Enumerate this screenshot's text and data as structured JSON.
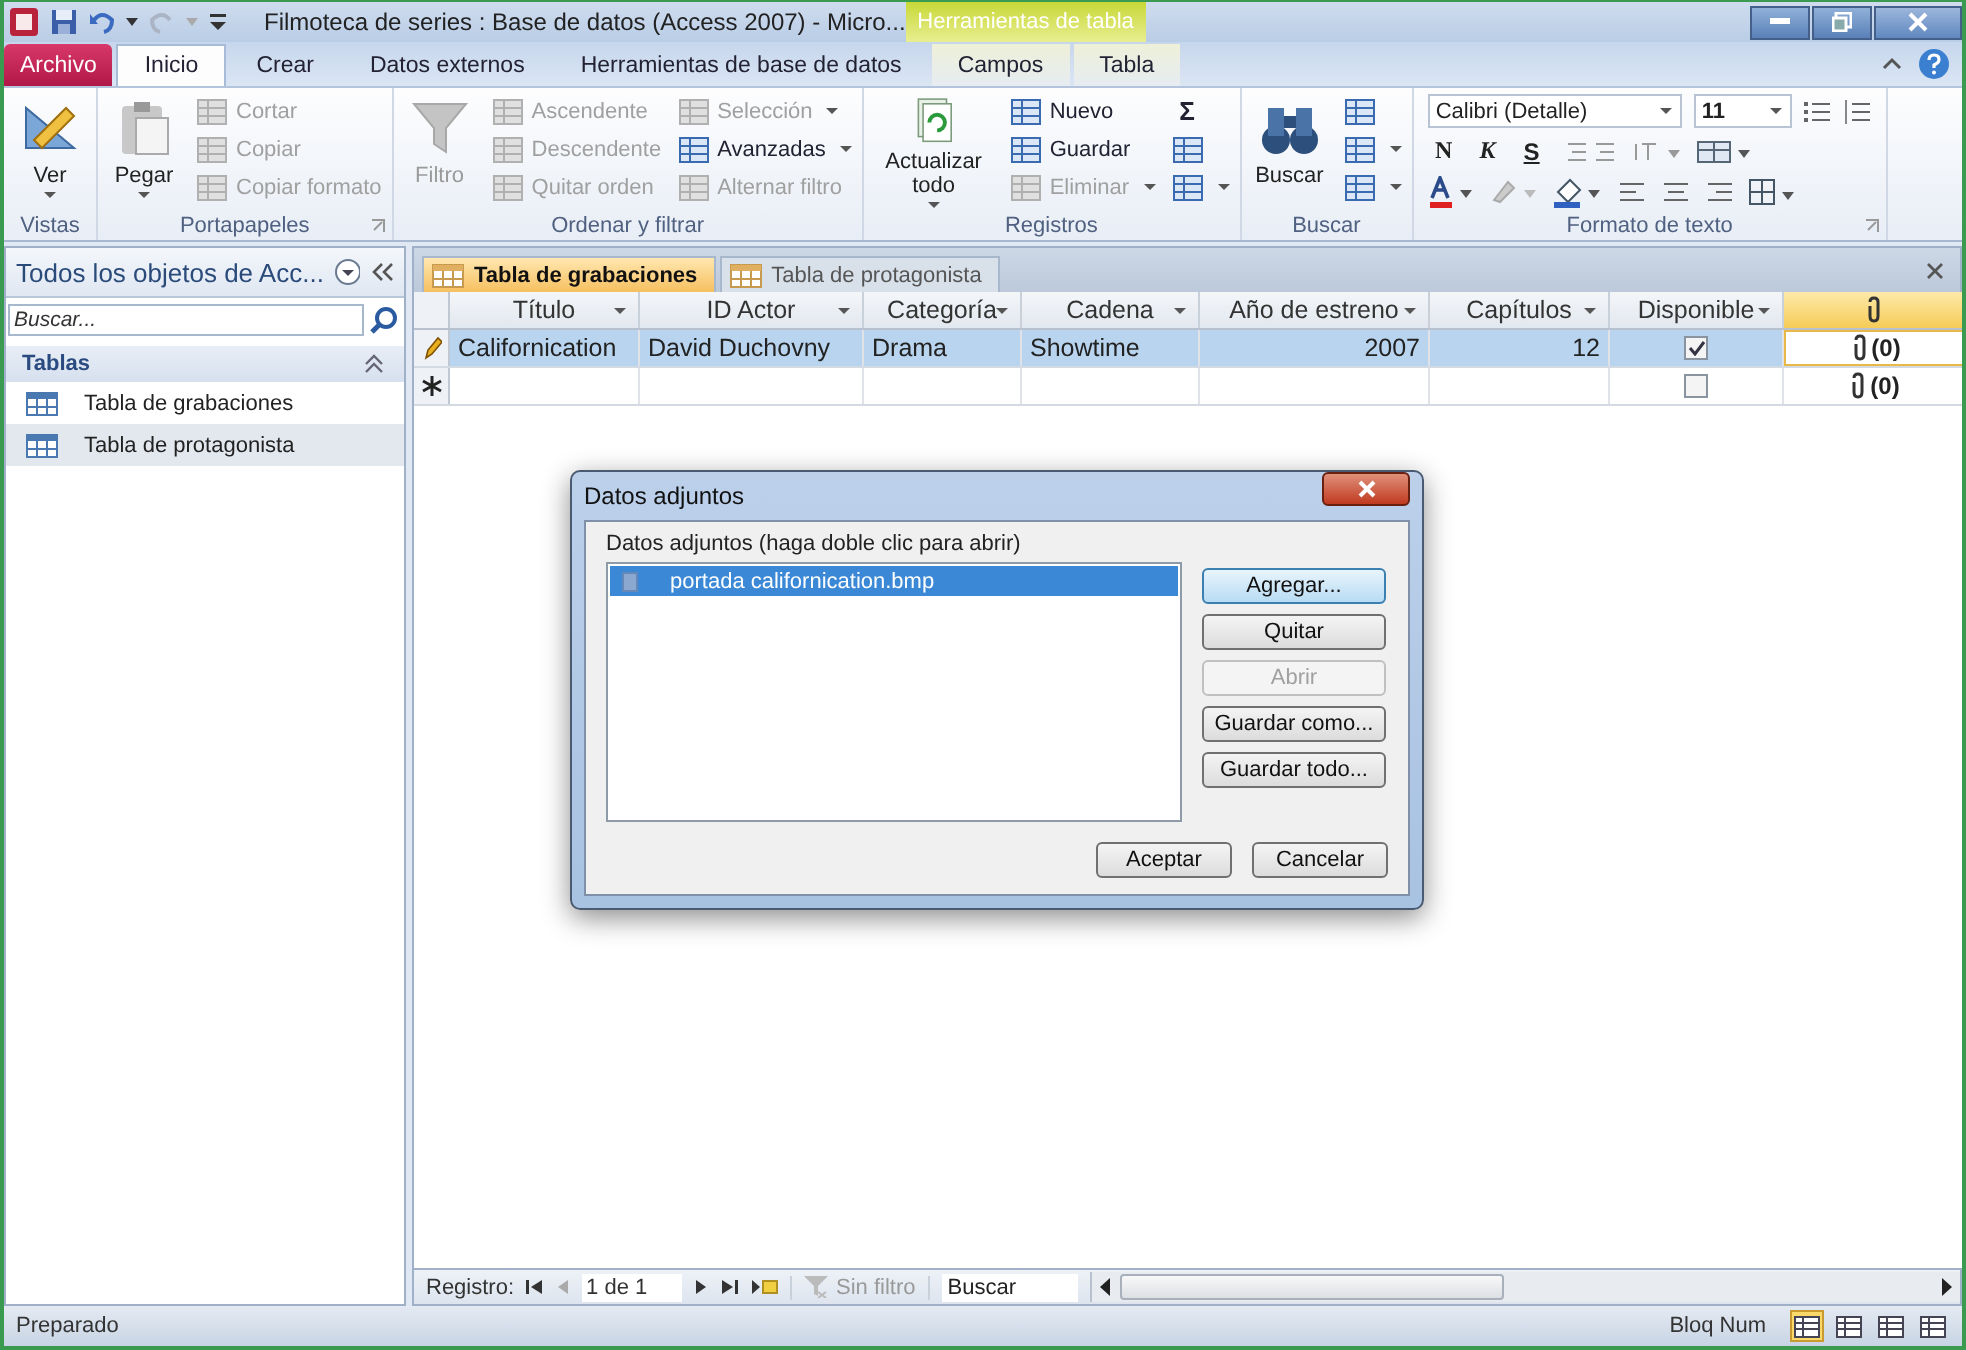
{
  "window": {
    "title": "Filmoteca de series : Base de datos (Access 2007)  -  Micro...",
    "context_header": "Herramientas de tabla"
  },
  "ribbon_tabs": [
    {
      "label": "Archivo",
      "kind": "file",
      "selected": false
    },
    {
      "label": "Inicio",
      "kind": "tab",
      "selected": true
    },
    {
      "label": "Crear",
      "kind": "tab",
      "selected": false
    },
    {
      "label": "Datos externos",
      "kind": "tab",
      "selected": false
    },
    {
      "label": "Herramientas de base de datos",
      "kind": "tab",
      "selected": false
    },
    {
      "label": "Campos",
      "kind": "context",
      "selected": false
    },
    {
      "label": "Tabla",
      "kind": "context",
      "selected": false
    }
  ],
  "ribbon": {
    "groups": [
      {
        "label": "Vistas",
        "kind": "commands",
        "parts": [
          {
            "kind": "large",
            "label": "Ver",
            "dropdown": true,
            "disabled": false
          }
        ]
      },
      {
        "label": "Portapapeles",
        "kind": "commands",
        "launcher": true,
        "parts": [
          {
            "kind": "large",
            "label": "Pegar",
            "dropdown": true,
            "disabled": false
          },
          {
            "kind": "column",
            "items": [
              {
                "kind": "command",
                "label": "Cortar",
                "disabled": true
              },
              {
                "kind": "command",
                "label": "Copiar",
                "disabled": true
              },
              {
                "kind": "command",
                "label": "Copiar formato",
                "disabled": true
              }
            ]
          }
        ]
      },
      {
        "label": "Ordenar y filtrar",
        "kind": "commands",
        "parts": [
          {
            "kind": "large",
            "label": "Filtro",
            "disabled": true
          },
          {
            "kind": "column",
            "items": [
              {
                "kind": "command",
                "label": "Ascendente",
                "disabled": true
              },
              {
                "kind": "command",
                "label": "Descendente",
                "disabled": true
              },
              {
                "kind": "command",
                "label": "Quitar orden",
                "disabled": true
              }
            ]
          },
          {
            "kind": "column",
            "items": [
              {
                "kind": "command",
                "label": "Selección",
                "disabled": true,
                "dropdown": true
              },
              {
                "kind": "command",
                "label": "Avanzadas",
                "disabled": false,
                "dropdown": true
              },
              {
                "kind": "command",
                "label": "Alternar filtro",
                "disabled": true
              }
            ]
          }
        ]
      },
      {
        "label": "Registros",
        "kind": "commands",
        "parts": [
          {
            "kind": "large",
            "label": "Actualizar todo",
            "dropdown": true,
            "disabled": false
          },
          {
            "kind": "column",
            "items": [
              {
                "kind": "command",
                "label": "Nuevo",
                "disabled": false
              },
              {
                "kind": "command",
                "label": "Guardar",
                "disabled": false
              },
              {
                "kind": "command",
                "label": "Eliminar",
                "disabled": true,
                "dropdown": true
              }
            ]
          },
          {
            "kind": "column",
            "items": [
              {
                "kind": "glyph",
                "label": "Σ",
                "disabled": false
              },
              {
                "kind": "command",
                "disabled": false
              },
              {
                "kind": "command",
                "disabled": false,
                "dropdown": true
              }
            ]
          }
        ]
      },
      {
        "label": "Buscar",
        "kind": "commands",
        "parts": [
          {
            "kind": "large",
            "label": "Buscar",
            "disabled": false
          },
          {
            "kind": "column",
            "items": [
              {
                "kind": "command",
                "disabled": false
              },
              {
                "kind": "command",
                "disabled": false,
                "dropdown": true
              },
              {
                "kind": "command",
                "disabled": false,
                "dropdown": true
              }
            ]
          }
        ]
      },
      {
        "label": "Formato de texto",
        "kind": "font",
        "launcher": true,
        "font": "Calibri (Detalle)",
        "size": "11",
        "styles": [
          "N",
          "K",
          "S"
        ]
      }
    ]
  },
  "navigation": {
    "title": "Todos los objetos de Acc...",
    "search": {
      "placeholder": "Buscar..."
    },
    "section": "Tablas",
    "items": [
      {
        "label": "Tabla de grabaciones",
        "selected": false
      },
      {
        "label": "Tabla de protagonista",
        "selected": true
      }
    ]
  },
  "document_tabs": [
    {
      "label": "Tabla de grabaciones",
      "selected": true
    },
    {
      "label": "Tabla de protagonista",
      "selected": false
    }
  ],
  "table": {
    "columns": [
      {
        "label": "Título",
        "kind": "text"
      },
      {
        "label": "ID Actor",
        "kind": "text"
      },
      {
        "label": "Categoría",
        "kind": "text"
      },
      {
        "label": "Cadena",
        "kind": "text"
      },
      {
        "label": "Año de estreno",
        "kind": "number"
      },
      {
        "label": "Capítulos",
        "kind": "number"
      },
      {
        "label": "Disponible",
        "kind": "checkbox"
      },
      {
        "kind": "attachment"
      }
    ],
    "rows": [
      {
        "kind": "current",
        "selected": true,
        "cells": [
          "Californication",
          "David Duchovny",
          "Drama",
          "Showtime",
          "2007",
          "12"
        ],
        "available": true,
        "attachments": "(0)"
      },
      {
        "kind": "new",
        "selected": false,
        "available": false,
        "attachments": "(0)"
      }
    ]
  },
  "record_navigation": {
    "label": "Registro:",
    "position": "1 de 1",
    "filter": "Sin filtro",
    "search": {
      "placeholder": "Buscar"
    }
  },
  "dialog": {
    "title": "Datos adjuntos",
    "list_label": "Datos adjuntos (haga doble clic para abrir)",
    "files": [
      {
        "name": "portada californication.bmp",
        "selected": true
      }
    ],
    "side_buttons": [
      {
        "label": "Agregar...",
        "disabled": false,
        "default": true
      },
      {
        "label": "Quitar",
        "disabled": false,
        "default": false
      },
      {
        "label": "Abrir",
        "disabled": true,
        "default": false
      },
      {
        "label": "Guardar como...",
        "disabled": false,
        "default": false
      },
      {
        "label": "Guardar todo...",
        "disabled": false,
        "default": false
      }
    ],
    "buttons": [
      "Aceptar",
      "Cancelar"
    ]
  },
  "status_bar": {
    "text": "Preparado",
    "indicator": "Bloq Num",
    "views": [
      {
        "selected": true
      },
      {
        "selected": false
      },
      {
        "selected": false
      },
      {
        "selected": false
      }
    ]
  }
}
